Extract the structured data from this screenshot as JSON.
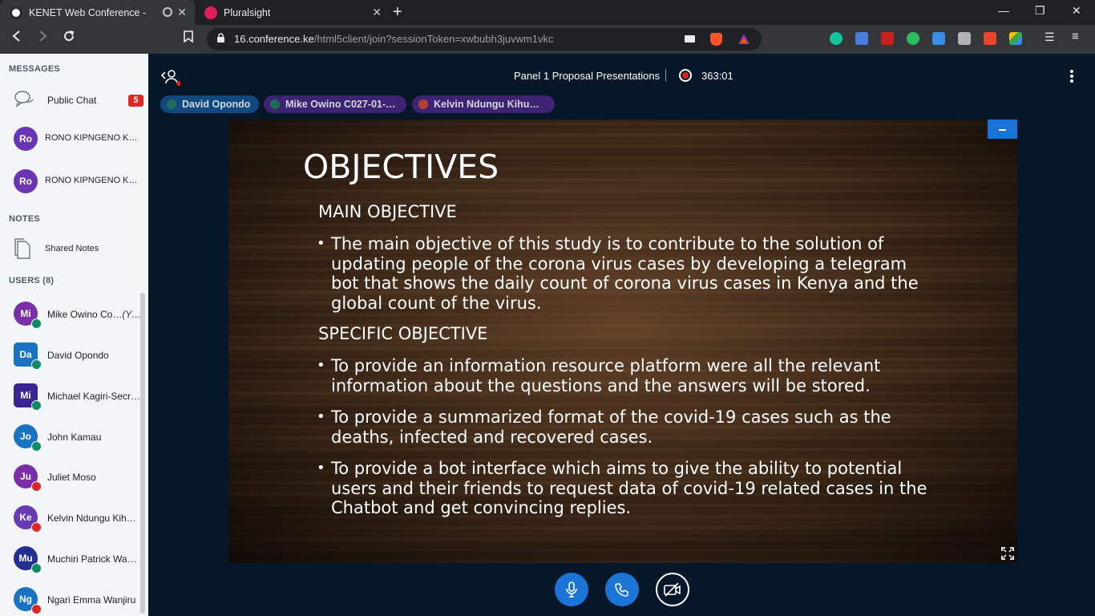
{
  "browser": {
    "tabs": [
      {
        "title": "KENET Web Conference - Panel",
        "active": true
      },
      {
        "title": "Pluralsight",
        "active": false
      }
    ],
    "url_host": "16.conference.ke",
    "url_path": "/html5client/join?sessionToken=xwbubh3juvwm1vkc"
  },
  "sidebar": {
    "messages_header": "MESSAGES",
    "public_chat": {
      "label": "Public Chat",
      "badge": "5"
    },
    "chats": [
      {
        "initials": "Ro",
        "name": "RONO KIPNGENO KE…"
      },
      {
        "initials": "Ro",
        "name": "RONO KIPNGENO KE…"
      }
    ],
    "notes_header": "NOTES",
    "shared_notes": "Shared Notes",
    "users_header": "USERS (8)",
    "users": [
      {
        "initials": "Mi",
        "name": "Mike Owino Co…",
        "you": "(You)",
        "color": "#7a2fa8",
        "status": "listen"
      },
      {
        "initials": "Da",
        "name": "David Opondo",
        "color": "#1a73c2",
        "status": "listen"
      },
      {
        "initials": "Mi",
        "name": "Michael Kagiri-Secr…",
        "color": "#3b2593",
        "status": "listen"
      },
      {
        "initials": "Jo",
        "name": "John Kamau",
        "color": "#1a73c2",
        "status": "listen"
      },
      {
        "initials": "Ju",
        "name": "Juliet Moso",
        "color": "#7a2fa8",
        "status": "muted"
      },
      {
        "initials": "Ke",
        "name": "Kelvin Ndungu Kihu…",
        "color": "#6a3ab5",
        "status": "muted"
      },
      {
        "initials": "Mu",
        "name": "Muchiri Patrick Wa…",
        "color": "#24308f",
        "status": "listen"
      },
      {
        "initials": "Ng",
        "name": "Ngari Emma Wanjiru",
        "color": "#1a73c2",
        "status": "muted"
      }
    ]
  },
  "header": {
    "session_title": "Panel 1 Proposal Presentations",
    "timer": "363:01",
    "talkers": [
      {
        "name": "David Opondo",
        "bg": "#11497f",
        "dot": "#1e6d5a"
      },
      {
        "name": "Mike Owino C027-01-…",
        "bg": "#3e2373",
        "dot": "#1e6d5a"
      },
      {
        "name": "Kelvin Ndungu Kihu…",
        "bg": "#3e2373",
        "dot": "#b0423a"
      }
    ]
  },
  "slide": {
    "title": "OBJECTIVES",
    "main_heading": "MAIN OBJECTIVE",
    "main_bullet": "The main objective of this study is to contribute to the solution of updating people of the corona virus cases by developing a telegram bot that shows the daily count of corona virus cases in Kenya and the global count of the virus.",
    "specific_heading": "SPECIFIC OBJECTIVE",
    "specific_bullets": [
      "To provide an information resource platform were all the relevant information about the questions and the answers will be stored.",
      "To provide a summarized format of the covid-19 cases such as the deaths, infected and recovered cases.",
      "To provide a bot interface which aims to give the ability to potential users and their friends to request data of covid-19 related cases in the Chatbot and get convincing replies."
    ]
  }
}
